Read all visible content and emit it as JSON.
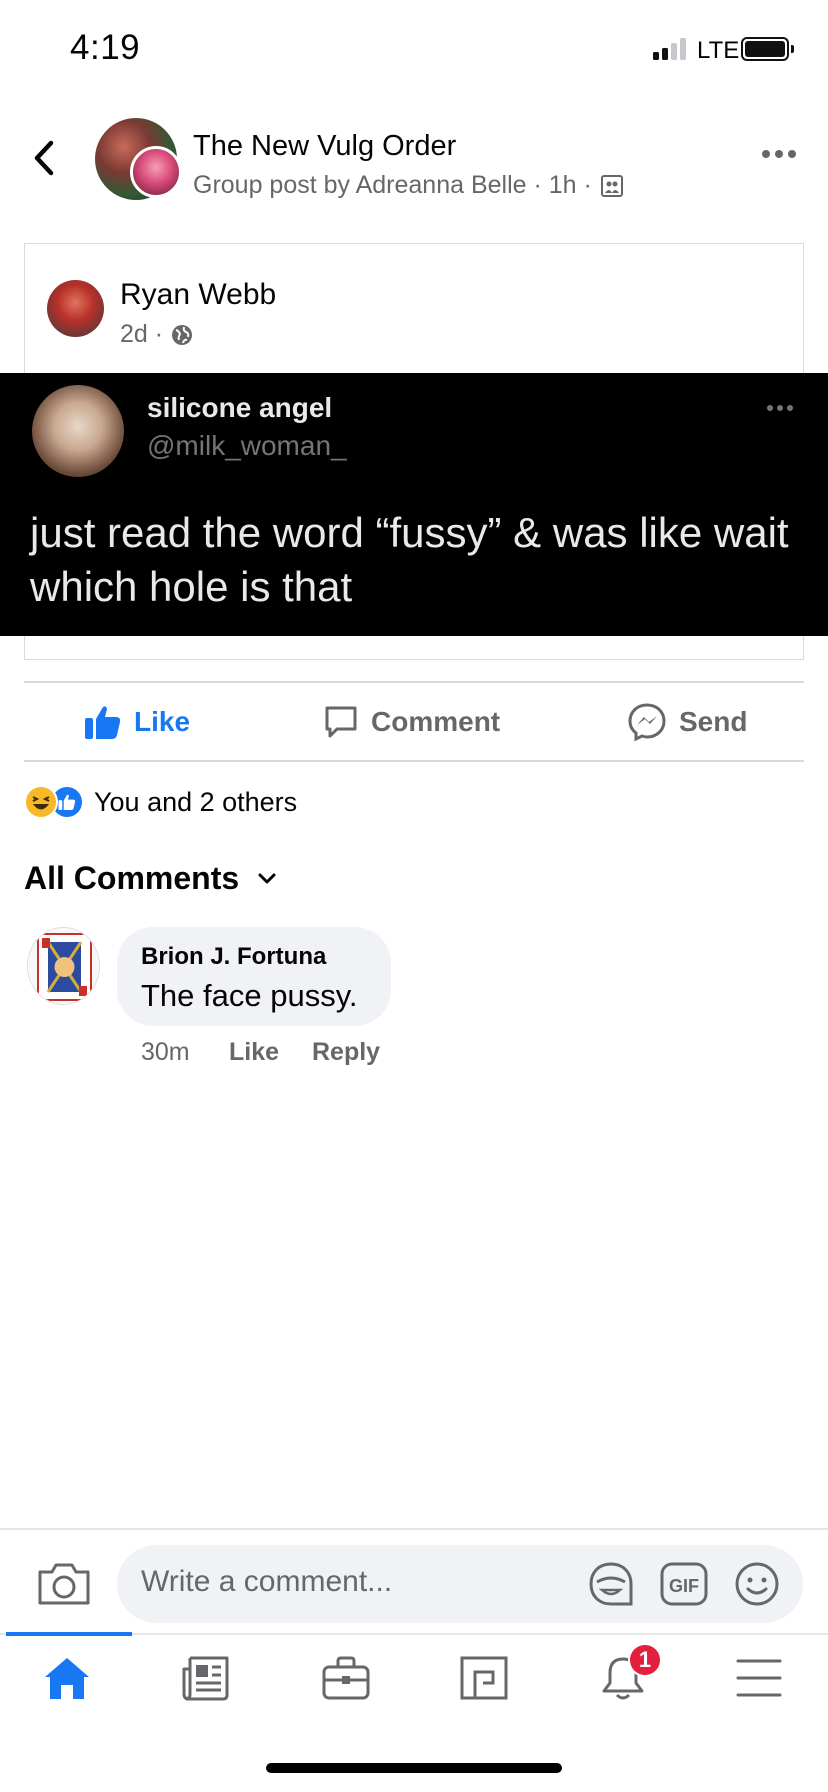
{
  "status_bar": {
    "time": "4:19",
    "network": "LTE"
  },
  "header": {
    "group_name": "The New Vulg Order",
    "post_meta": "Group post by Adreanna Belle · 1h ·"
  },
  "shared_post": {
    "author": "Ryan Webb",
    "time": "2d ·",
    "tweet": {
      "display_name": "silicone angel",
      "handle": "@milk_woman_",
      "text": "just read the word “fussy” & was like wait which hole is that"
    }
  },
  "actions": {
    "like": "Like",
    "comment": "Comment",
    "send": "Send"
  },
  "reactions": {
    "summary": "You and 2 others"
  },
  "comments_filter": "All Comments",
  "comments": [
    {
      "author": "Brion J. Fortuna",
      "text": "The face pussy.",
      "time": "30m",
      "like": "Like",
      "reply": "Reply"
    }
  ],
  "composer": {
    "placeholder": "Write a comment..."
  },
  "nav": {
    "items": [
      "home-icon",
      "news-icon",
      "marketplace-icon",
      "pages-icon",
      "notifications-icon",
      "menu-icon"
    ],
    "notifications_badge": "1"
  },
  "colors": {
    "accent": "#1877f2",
    "secondary_text": "#65676b",
    "badge": "#e41e3f"
  }
}
